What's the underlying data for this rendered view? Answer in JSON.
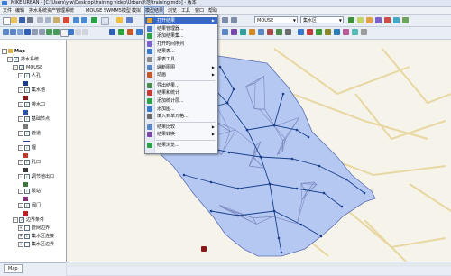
{
  "title": "MIKE URBAN - [C:\\Users\\yjw\\Desktop\\training video\\Urban示范\\training.mdb] - 版本",
  "menu": [
    "文件",
    "编辑",
    "排水系统资产管理系统",
    "MOUSE",
    "SWMM5模型",
    "模拟",
    "模型结果",
    "浏览",
    "工具",
    "窗口",
    "帮助"
  ],
  "toolbar": {
    "layer_combo": "MOUSE",
    "target_combo": "集水区"
  },
  "dropdown": {
    "items": [
      {
        "label": "打开结果",
        "submenu": true,
        "icon": "folder-open-icon"
      },
      {
        "label": "结果管理器...",
        "submenu": false,
        "icon": "manager-icon"
      },
      {
        "label": "添加结果集...",
        "submenu": false,
        "icon": "add-icon"
      },
      {
        "label": "打开时间序列",
        "submenu": false,
        "icon": "timeseries-icon"
      },
      {
        "label": "结果表...",
        "submenu": false,
        "icon": "table-icon"
      },
      {
        "label": "报表工具...",
        "submenu": false,
        "icon": "report-icon"
      },
      {
        "label": "纵断图图",
        "submenu": true,
        "icon": "profile-icon"
      },
      {
        "label": "动画",
        "submenu": true,
        "icon": "animation-icon"
      },
      {
        "label": "导出结果...",
        "submenu": false,
        "icon": "export-icon"
      },
      {
        "label": "结果和统计",
        "submenu": false,
        "icon": "stats-icon"
      },
      {
        "label": "添加统计层...",
        "submenu": false,
        "icon": "layer-icon"
      },
      {
        "label": "添加图...",
        "submenu": false,
        "icon": "chart-icon"
      },
      {
        "label": "填入到单元格...",
        "submenu": false,
        "icon": "cell-icon"
      },
      {
        "label": "结果比较",
        "submenu": true,
        "icon": "compare-icon"
      },
      {
        "label": "结果转换",
        "submenu": true,
        "icon": "convert-icon"
      },
      {
        "label": "结果浏览...",
        "submenu": false,
        "icon": "browse-icon"
      }
    ]
  },
  "layers": [
    {
      "label": "Map",
      "indent": 0,
      "type": "group",
      "checked": false,
      "expand": "-",
      "bold": true
    },
    {
      "label": "排水系统",
      "indent": 1,
      "type": "group",
      "checked": true,
      "expand": "-"
    },
    {
      "label": "MOUSE",
      "indent": 2,
      "type": "group",
      "checked": true,
      "expand": "-"
    },
    {
      "label": "人孔",
      "indent": 3,
      "type": "layer",
      "checked": true,
      "expand": "-"
    },
    {
      "label": "",
      "indent": 4,
      "type": "symbol",
      "color": "#1a3f8c"
    },
    {
      "label": "集水池",
      "indent": 3,
      "type": "layer",
      "checked": true,
      "expand": "-"
    },
    {
      "label": "",
      "indent": 4,
      "type": "symbol",
      "color": "#8a1a1a"
    },
    {
      "label": "排水口",
      "indent": 3,
      "type": "layer",
      "checked": true,
      "expand": "-"
    },
    {
      "label": "",
      "indent": 4,
      "type": "symbol",
      "color": "#2a55a8"
    },
    {
      "label": "基础节点",
      "indent": 3,
      "type": "layer",
      "checked": true,
      "expand": "-"
    },
    {
      "label": "",
      "indent": 4,
      "type": "symbol",
      "color": "#7a7a7a"
    },
    {
      "label": "管道",
      "indent": 3,
      "type": "layer",
      "checked": true,
      "expand": "-"
    },
    {
      "label": "",
      "indent": 4,
      "type": "line",
      "color": "#1a3f8c"
    },
    {
      "label": "堰",
      "indent": 3,
      "type": "layer",
      "checked": true,
      "expand": "-"
    },
    {
      "label": "",
      "indent": 4,
      "type": "symbol",
      "color": "#c43a2a"
    },
    {
      "label": "孔口",
      "indent": 3,
      "type": "layer",
      "checked": true,
      "expand": "-"
    },
    {
      "label": "",
      "indent": 4,
      "type": "symbol",
      "color": "#3a3a3a"
    },
    {
      "label": "调节池出口",
      "indent": 3,
      "type": "layer",
      "checked": true,
      "expand": "-"
    },
    {
      "label": "",
      "indent": 4,
      "type": "symbol",
      "color": "#3a7a3a"
    },
    {
      "label": "泵站",
      "indent": 3,
      "type": "layer",
      "checked": true,
      "expand": "-"
    },
    {
      "label": "",
      "indent": 4,
      "type": "symbol",
      "color": "#8a2a7a"
    },
    {
      "label": "阀门",
      "indent": 3,
      "type": "layer",
      "checked": true,
      "expand": "-"
    },
    {
      "label": "",
      "indent": 4,
      "type": "symbol",
      "color": "#c02020"
    },
    {
      "label": "边界条件",
      "indent": 2,
      "type": "group",
      "checked": true,
      "expand": "-"
    },
    {
      "label": "管网边界",
      "indent": 3,
      "type": "layer",
      "checked": false,
      "expand": "+"
    },
    {
      "label": "集水区连接",
      "indent": 3,
      "type": "layer",
      "checked": true,
      "expand": "+"
    },
    {
      "label": "集水区边界",
      "indent": 3,
      "type": "layer",
      "checked": false,
      "expand": "+"
    }
  ],
  "panel_tab": "Map",
  "colors": {
    "catchment_fill": "#b4c8f2",
    "catchment_edge": "#5e6fb0",
    "pipe": "#1a3f8c",
    "menu_highlight": "#3569c4"
  }
}
